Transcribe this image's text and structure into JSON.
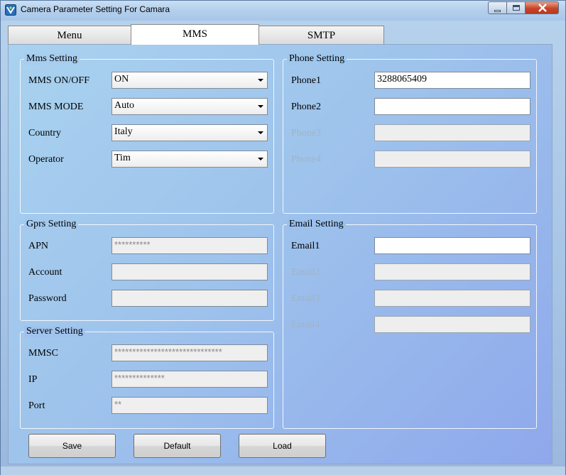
{
  "window": {
    "title": "Camera Parameter Setting For  Camara",
    "icon": "app-camera-icon"
  },
  "tabs": [
    {
      "label": "Menu",
      "selected": false
    },
    {
      "label": "MMS",
      "selected": true
    },
    {
      "label": "SMTP",
      "selected": false
    }
  ],
  "mms_setting": {
    "title": "Mms Setting",
    "rows": [
      {
        "label": "MMS ON/OFF",
        "value": "ON"
      },
      {
        "label": "MMS MODE",
        "value": "Auto"
      },
      {
        "label": "Country",
        "value": "Italy"
      },
      {
        "label": "Operator",
        "value": "Tim"
      }
    ]
  },
  "phone_setting": {
    "title": "Phone Setting",
    "rows": [
      {
        "label": "Phone1",
        "value": "3288065409",
        "enabled": true
      },
      {
        "label": "Phone2",
        "value": "",
        "enabled": true
      },
      {
        "label": "Phone3",
        "value": "",
        "enabled": false
      },
      {
        "label": "Phone4",
        "value": "",
        "enabled": false
      }
    ]
  },
  "gprs_setting": {
    "title": "Gprs Setting",
    "rows": [
      {
        "label": "APN",
        "value": "**********"
      },
      {
        "label": "Account",
        "value": ""
      },
      {
        "label": "Password",
        "value": ""
      }
    ]
  },
  "email_setting": {
    "title": "Email Setting",
    "rows": [
      {
        "label": "Email1",
        "value": "",
        "enabled": true
      },
      {
        "label": "Email2",
        "value": "",
        "enabled": false
      },
      {
        "label": "Email3",
        "value": "",
        "enabled": false
      },
      {
        "label": "Email4",
        "value": "",
        "enabled": false
      }
    ]
  },
  "server_setting": {
    "title": "Server Setting",
    "rows": [
      {
        "label": "MMSC",
        "value": "******************************"
      },
      {
        "label": "IP",
        "value": "**************"
      },
      {
        "label": "Port",
        "value": "**"
      }
    ]
  },
  "buttons": {
    "save": "Save",
    "default": "Default",
    "load": "Load"
  },
  "colors": {
    "panel_start": "#a9d2ef",
    "panel_end": "#8fa8ec",
    "close_button": "#c8452a",
    "disabled_label": "#9fb3c6"
  }
}
